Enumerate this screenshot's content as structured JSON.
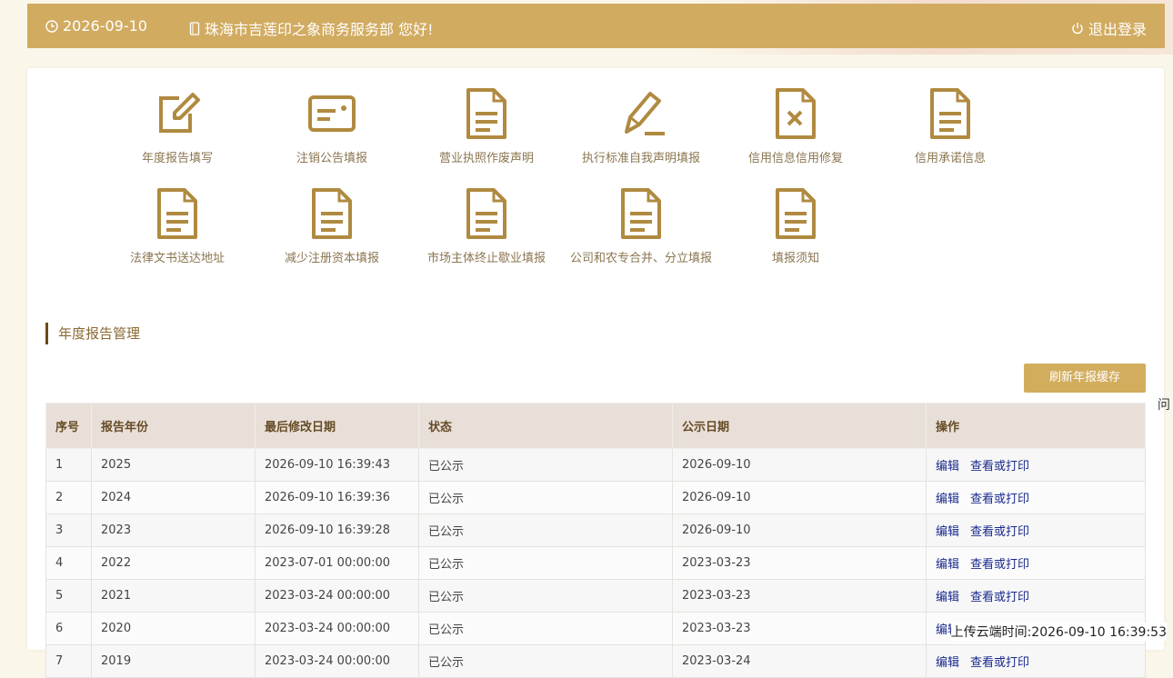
{
  "header": {
    "date": "2026-09-10",
    "greeting": "珠海市吉莲印之象商务服务部 您好!",
    "logout": "退出登录"
  },
  "tiles": [
    {
      "label": "年度报告填写",
      "icon": "edit-icon"
    },
    {
      "label": "注销公告填报",
      "icon": "id-card-icon"
    },
    {
      "label": "营业执照作废声明",
      "icon": "document-icon"
    },
    {
      "label": "执行标准自我声明填报",
      "icon": "pencil-icon"
    },
    {
      "label": "信用信息信用修复",
      "icon": "document-x-icon"
    },
    {
      "label": "信用承诺信息",
      "icon": "document-icon"
    },
    {
      "label": "法律文书送达地址",
      "icon": "document-icon"
    },
    {
      "label": "减少注册资本填报",
      "icon": "document-icon"
    },
    {
      "label": "市场主体终止歇业填报",
      "icon": "document-icon"
    },
    {
      "label": "公司和农专合并、分立填报",
      "icon": "document-icon"
    },
    {
      "label": "填报须知",
      "icon": "document-icon"
    }
  ],
  "section": {
    "title": "年度报告管理",
    "refresh": "刷新年报缓存"
  },
  "stray_char": "问",
  "table": {
    "headers": [
      "序号",
      "报告年份",
      "最后修改日期",
      "状态",
      "公示日期",
      "操作"
    ],
    "rows": [
      [
        "1",
        "2025",
        "2026-09-10 16:39:43",
        "已公示",
        "2026-09-10"
      ],
      [
        "2",
        "2024",
        "2026-09-10 16:39:36",
        "已公示",
        "2026-09-10"
      ],
      [
        "3",
        "2023",
        "2026-09-10 16:39:28",
        "已公示",
        "2026-09-10"
      ],
      [
        "4",
        "2022",
        "2023-07-01 00:00:00",
        "已公示",
        "2023-03-23"
      ],
      [
        "5",
        "2021",
        "2023-03-24 00:00:00",
        "已公示",
        "2023-03-23"
      ],
      [
        "6",
        "2020",
        "2023-03-24 00:00:00",
        "已公示",
        "2023-03-23"
      ],
      [
        "7",
        "2019",
        "2023-03-24 00:00:00",
        "已公示",
        "2023-03-24"
      ]
    ],
    "action_edit": "编辑",
    "action_view": "查看或打印"
  },
  "footer": {
    "upload_time": "上传云端时间:2026-09-10 16:39:53"
  }
}
